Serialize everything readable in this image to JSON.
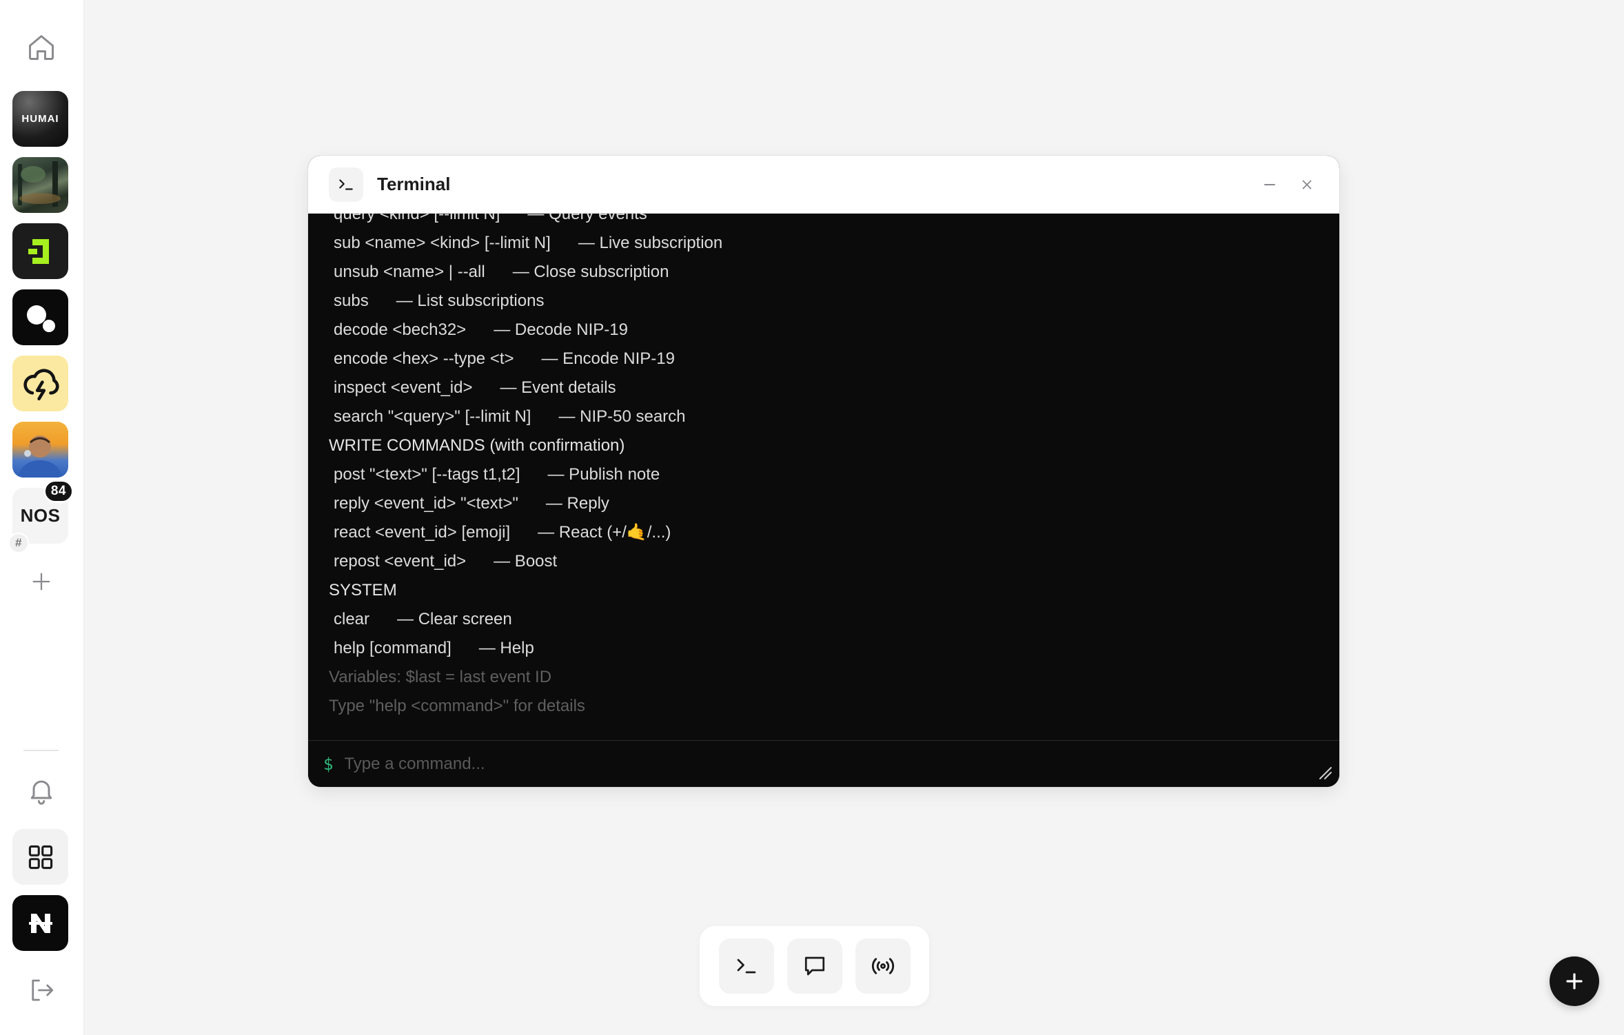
{
  "sidebar": {
    "home_icon": "home-icon",
    "communities": [
      {
        "name": "human-avatar",
        "label": "HUMAI"
      },
      {
        "name": "forest-avatar",
        "label": ""
      },
      {
        "name": "green-logo-avatar",
        "label": ""
      },
      {
        "name": "dots-logo-avatar",
        "label": ""
      },
      {
        "name": "lightning-cloud-avatar",
        "label": ""
      },
      {
        "name": "person-avatar",
        "label": ""
      }
    ],
    "nos": {
      "label": "NOS",
      "badge": "84",
      "hash": "#"
    },
    "add_icon": "plus-icon",
    "bell_icon": "bell-icon",
    "apps_icon": "grid-icon",
    "n_logo_icon": "n-logo-icon",
    "logout_icon": "logout-icon"
  },
  "terminal": {
    "title": "Terminal",
    "lines": [
      {
        "type": "cmd",
        "cmd": "query <kind> [--limit N]",
        "desc": "— Query events"
      },
      {
        "type": "cmd",
        "cmd": "sub <name> <kind> [--limit N]",
        "desc": "— Live subscription"
      },
      {
        "type": "cmd",
        "cmd": "unsub <name> | --all",
        "desc": "— Close subscription"
      },
      {
        "type": "cmd",
        "cmd": "subs",
        "desc": "— List subscriptions"
      },
      {
        "type": "cmd",
        "cmd": "decode <bech32>",
        "desc": "— Decode NIP-19"
      },
      {
        "type": "cmd",
        "cmd": "encode <hex> --type <t>",
        "desc": "— Encode NIP-19"
      },
      {
        "type": "cmd",
        "cmd": "inspect <event_id>",
        "desc": "— Event details"
      },
      {
        "type": "cmd",
        "cmd": "search \"<query>\" [--limit N]",
        "desc": "— NIP-50 search"
      },
      {
        "type": "section",
        "text": "WRITE COMMANDS (with confirmation)"
      },
      {
        "type": "cmd",
        "cmd": "post \"<text>\" [--tags t1,t2]",
        "desc": "— Publish note"
      },
      {
        "type": "cmd",
        "cmd": "reply <event_id> \"<text>\"",
        "desc": "— Reply"
      },
      {
        "type": "cmd",
        "cmd": "react <event_id> [emoji]",
        "desc": "— React (+/🤙/...)"
      },
      {
        "type": "cmd",
        "cmd": "repost <event_id>",
        "desc": "— Boost"
      },
      {
        "type": "section",
        "text": "SYSTEM"
      },
      {
        "type": "cmd",
        "cmd": "clear",
        "desc": "— Clear screen"
      },
      {
        "type": "cmd",
        "cmd": "help [command]",
        "desc": "— Help"
      },
      {
        "type": "muted",
        "text": "Variables: $last = last event ID"
      },
      {
        "type": "muted",
        "text": "Type \"help <command>\" for details"
      }
    ],
    "prompt": "$",
    "input_placeholder": "Type a command...",
    "input_value": ""
  },
  "dock": {
    "items": [
      {
        "name": "terminal-dock-button",
        "icon": "terminal-icon"
      },
      {
        "name": "chat-dock-button",
        "icon": "chat-icon"
      },
      {
        "name": "broadcast-dock-button",
        "icon": "broadcast-icon"
      }
    ]
  },
  "fab": {
    "icon": "plus-icon"
  },
  "colors": {
    "page_bg": "#f4f4f5",
    "terminal_bg": "#0b0b0b",
    "prompt": "#2fb77a",
    "accent_green": "#a6f01f"
  }
}
